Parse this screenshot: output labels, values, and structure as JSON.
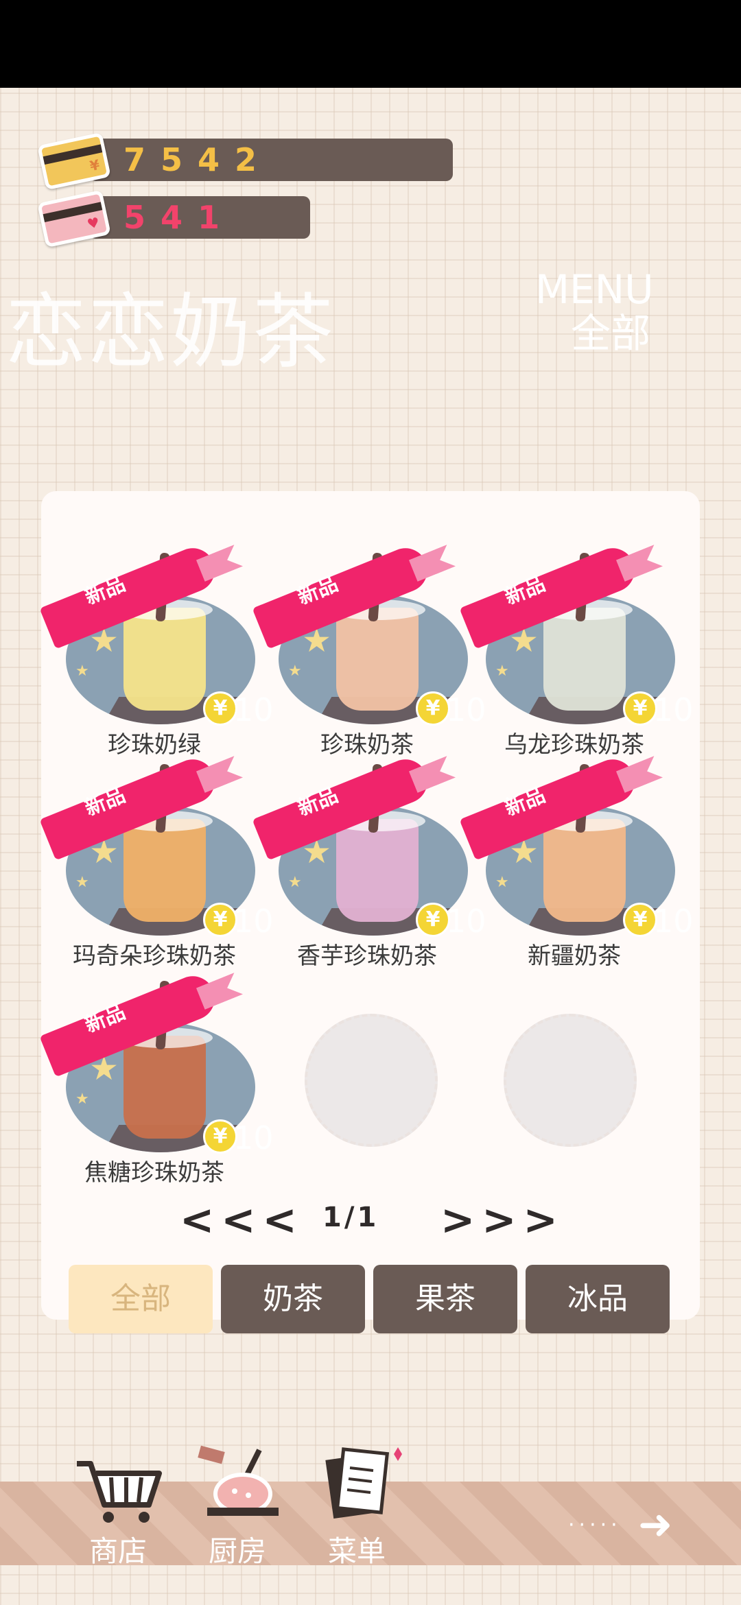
{
  "currency": {
    "gold_amount": "7542",
    "gold_card_mark": "¥",
    "love_amount": "541",
    "love_card_mark": "♥"
  },
  "shop": {
    "title": "恋恋奶茶",
    "menu_en": "MENU",
    "menu_category": "全部"
  },
  "ribbon_label": "新品",
  "coin_symbol": "¥",
  "items": [
    {
      "name": "珍珠奶绿",
      "price": "10",
      "cup_color": "#f5e48a"
    },
    {
      "name": "珍珠奶茶",
      "price": "10",
      "cup_color": "#f2c2a4"
    },
    {
      "name": "乌龙珍珠奶茶",
      "price": "10",
      "cup_color": "#dfe3d7"
    },
    {
      "name": "玛奇朵珍珠奶茶",
      "price": "10",
      "cup_color": "#f0b067"
    },
    {
      "name": "香芋珍珠奶茶",
      "price": "10",
      "cup_color": "#e3b1d2"
    },
    {
      "name": "新疆奶茶",
      "price": "10",
      "cup_color": "#f2b88a"
    },
    {
      "name": "焦糖珍珠奶茶",
      "price": "10",
      "cup_color": "#c8704c"
    }
  ],
  "pager": {
    "prev": "<<<",
    "page_text": "1/1",
    "next": ">>>"
  },
  "tabs": [
    {
      "label": "全部",
      "active": true
    },
    {
      "label": "奶茶",
      "active": false
    },
    {
      "label": "果茶",
      "active": false
    },
    {
      "label": "冰品",
      "active": false
    }
  ],
  "nav": {
    "shop": "商店",
    "kitchen": "厨房",
    "menu": "菜单",
    "more_dots": "·····",
    "more_arrow": "➜"
  }
}
